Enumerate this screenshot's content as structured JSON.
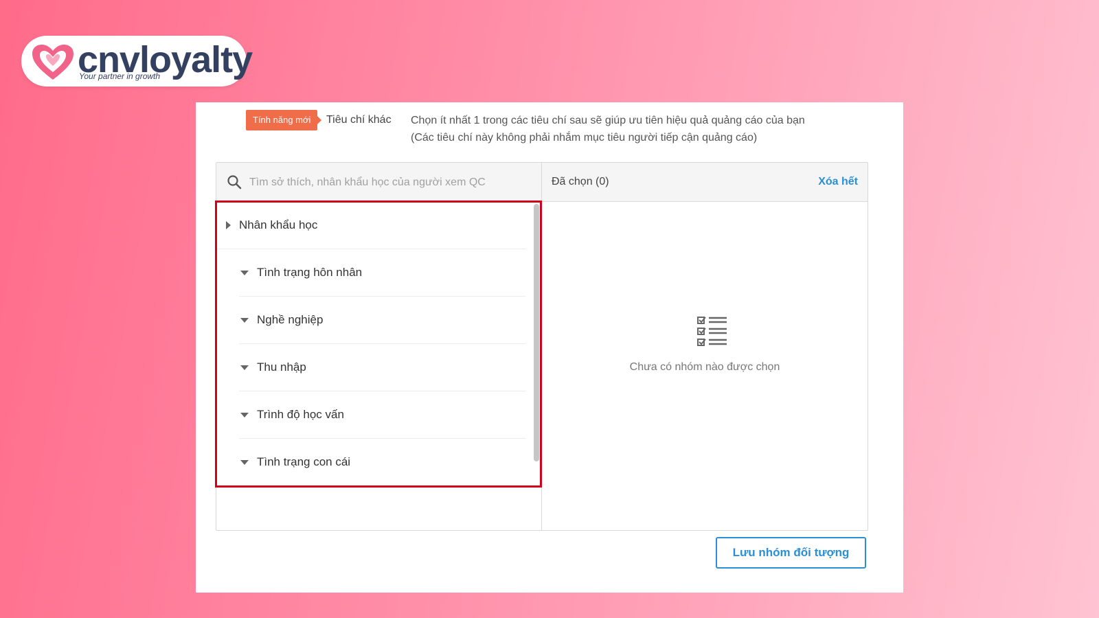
{
  "logo": {
    "name": "cnvloyalty",
    "tagline": "Your partner in growth",
    "brand_color": "#33405f",
    "heart_color": "#f2638a"
  },
  "header": {
    "badge_new": "Tính năng mới",
    "tab_label": "Tiêu chí khác",
    "hint_line1": "Chọn ít nhất 1 trong các tiêu chí sau sẽ giúp ưu tiên hiệu quả quảng cáo của bạn",
    "hint_line2": "(Các tiêu chí này không phải nhắm mục tiêu người tiếp cận quảng cáo)"
  },
  "search": {
    "placeholder": "Tìm sở thích, nhân khẩu học của người xem QC",
    "value": ""
  },
  "categories": {
    "root": {
      "label": "Nhân khẩu học",
      "icon": "caret-right-icon"
    },
    "items": [
      {
        "label": "Tình trạng hôn nhân",
        "icon": "caret-down-icon"
      },
      {
        "label": "Nghề nghiệp",
        "icon": "caret-down-icon"
      },
      {
        "label": "Thu nhập",
        "icon": "caret-down-icon"
      },
      {
        "label": "Trình độ học vấn",
        "icon": "caret-down-icon"
      },
      {
        "label": "Tình trạng con cái",
        "icon": "caret-down-icon"
      }
    ]
  },
  "selected": {
    "title": "Đã chọn (0)",
    "clear_all": "Xóa hết",
    "empty_icon": "checklist-icon",
    "empty_text": "Chưa có nhóm nào được chọn"
  },
  "actions": {
    "save_label": "Lưu nhóm đối tượng"
  },
  "colors": {
    "accent": "#2b8fd6",
    "badge": "#f06d4a",
    "highlight": "#d0021b"
  }
}
